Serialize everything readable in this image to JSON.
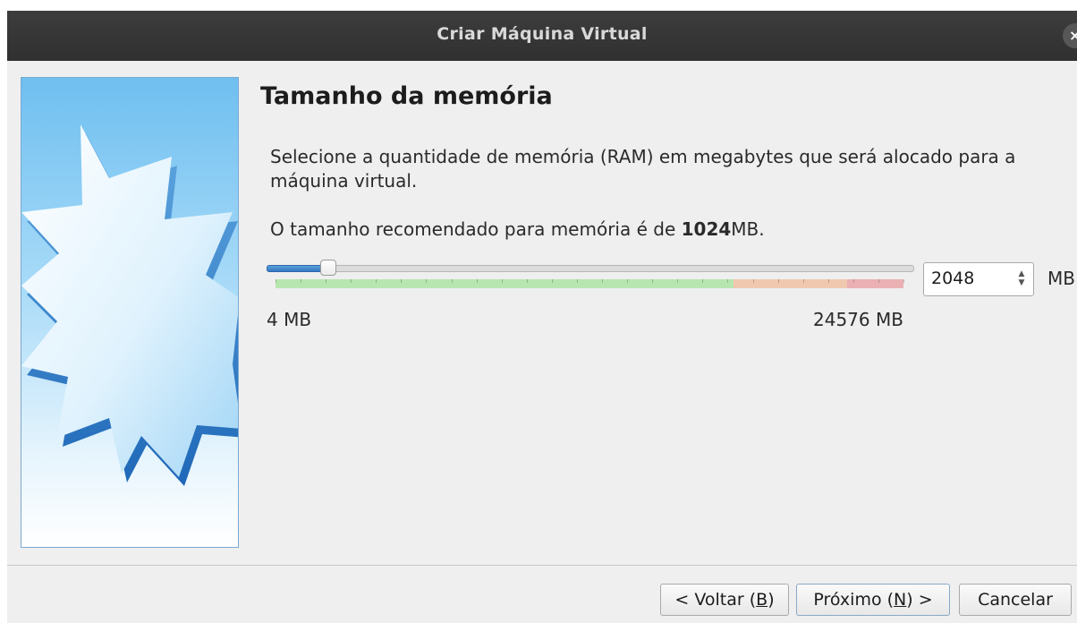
{
  "window": {
    "title": "Criar Máquina Virtual",
    "close_glyph": "×"
  },
  "page": {
    "heading": "Tamanho da memória",
    "description": "Selecione a quantidade de memória (RAM) em megabytes que será alocado para a máquina virtual.",
    "recommend_prefix": "O tamanho recomendado para memória é de ",
    "recommend_value": "1024",
    "recommend_suffix": "MB."
  },
  "memory": {
    "value": "2048",
    "unit": "MB",
    "min_label": "4 MB",
    "max_label": "24576 MB",
    "min": 4,
    "max": 24576,
    "current": 2048,
    "zones": {
      "green_fraction": 0.73,
      "orange_fraction": 0.18,
      "red_fraction": 0.09
    }
  },
  "buttons": {
    "back_prefix": "< Voltar (",
    "back_key": "B",
    "back_suffix": ")",
    "next_prefix": "Próximo (",
    "next_key": "N",
    "next_suffix": ") >",
    "cancel": "Cancelar"
  },
  "colors": {
    "titlebar": "#353535",
    "slider_fill": "#3478c0",
    "zone_green": "#b8e6b0",
    "zone_orange": "#f0c8b0",
    "zone_red": "#eab0b4"
  },
  "icons": {
    "close": "close-icon",
    "spin_up": "chevron-up-icon",
    "spin_down": "chevron-down-icon",
    "wizard_graphic": "starburst-graphic"
  }
}
